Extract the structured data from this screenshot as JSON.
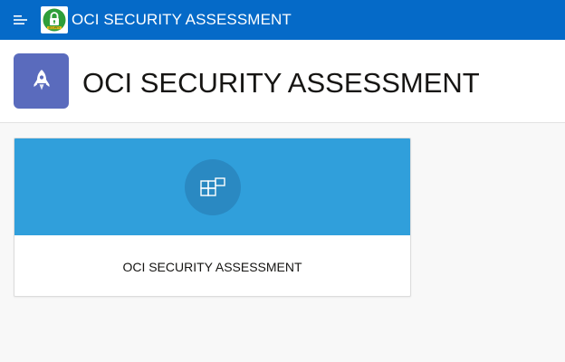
{
  "topbar": {
    "menu_icon": "hamburger-menu-icon",
    "logo_icon": "security-lock-icon",
    "logo_text": "SECURITY",
    "title": "OCI SECURITY ASSESSMENT",
    "color": "#056ac8"
  },
  "hero": {
    "icon": "rocket-icon",
    "icon_color": "#5a6bbd",
    "title": "OCI SECURITY ASSESSMENT"
  },
  "cards": [
    {
      "icon": "grid-layout-icon",
      "banner_color": "#309fdb",
      "label": "OCI SECURITY ASSESSMENT"
    }
  ]
}
